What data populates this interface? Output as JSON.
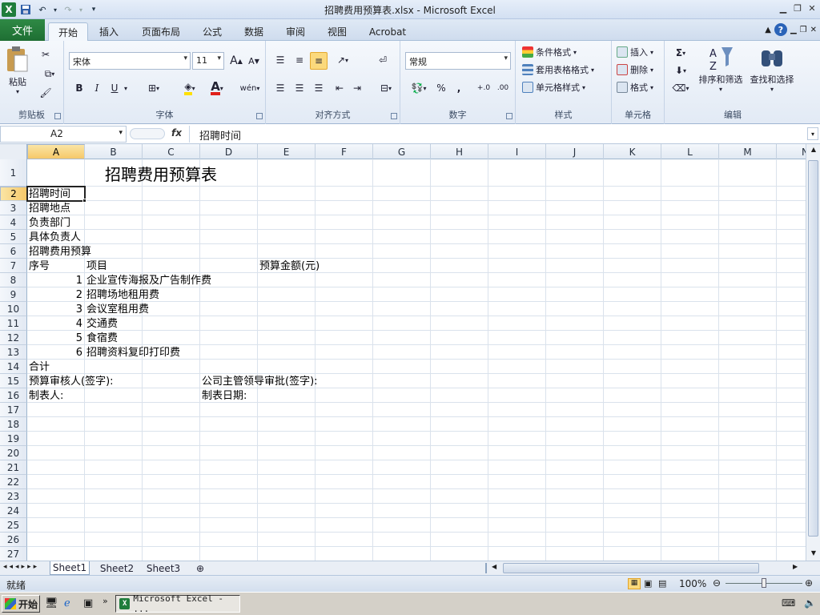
{
  "window": {
    "title": "招聘费用预算表.xlsx - Microsoft Excel"
  },
  "tabs": {
    "file": "文件",
    "items": [
      "开始",
      "插入",
      "页面布局",
      "公式",
      "数据",
      "审阅",
      "视图",
      "Acrobat"
    ],
    "active": "开始"
  },
  "ribbon": {
    "clipboard": {
      "paste": "粘贴",
      "label": "剪贴板"
    },
    "font": {
      "name": "宋体",
      "size": "11",
      "bold": "B",
      "italic": "I",
      "underline": "U",
      "label": "字体",
      "fontcolor_glyph": "A",
      "phonetic": "wén"
    },
    "alignment": {
      "label": "对齐方式"
    },
    "number": {
      "format": "常规",
      "percent": "%",
      "comma": ",",
      "label": "数字",
      "inc_decimal": "+.0",
      "dec_decimal": ".00"
    },
    "styles": {
      "conditional": "条件格式",
      "table": "套用表格格式",
      "cell": "单元格样式",
      "label": "样式"
    },
    "cells": {
      "insert": "插入",
      "delete": "删除",
      "format": "格式",
      "label": "单元格"
    },
    "editing": {
      "sort": "排序和筛选",
      "find": "查找和选择",
      "label": "编辑",
      "sum": "Σ"
    }
  },
  "formula": {
    "namebox": "A2",
    "fx": "fx",
    "content": "招聘时间"
  },
  "columns": [
    "A",
    "B",
    "C",
    "D",
    "E",
    "F",
    "G",
    "H",
    "I",
    "J",
    "K",
    "L",
    "M",
    "N"
  ],
  "rows": [
    "1",
    "2",
    "3",
    "4",
    "5",
    "6",
    "7",
    "8",
    "9",
    "10",
    "11",
    "12",
    "13",
    "14",
    "15",
    "16",
    "17",
    "18",
    "19",
    "20",
    "21",
    "22",
    "23",
    "24",
    "25",
    "26",
    "27"
  ],
  "cells": {
    "title": "招聘费用预算表",
    "a2": "招聘时间",
    "a3": "招聘地点",
    "a4": "负责部门",
    "a5": "具体负责人",
    "a6": "招聘费用预算",
    "a7": "序号",
    "b7": "项目",
    "e7": "预算金额(元)",
    "items": [
      {
        "no": "1",
        "name": "企业宣传海报及广告制作费"
      },
      {
        "no": "2",
        "name": "招聘场地租用费"
      },
      {
        "no": "3",
        "name": "会议室租用费"
      },
      {
        "no": "4",
        "name": "交通费"
      },
      {
        "no": "5",
        "name": "食宿费"
      },
      {
        "no": "6",
        "name": "招聘资料复印打印费"
      }
    ],
    "a14": "合计",
    "a15": "预算审核人(签字):",
    "d15": "公司主管领导审批(签字):",
    "a16": "制表人:",
    "d16": "制表日期:"
  },
  "sheets": [
    "Sheet1",
    "Sheet2",
    "Sheet3"
  ],
  "status": {
    "ready": "就绪",
    "zoom": "100%"
  },
  "taskbar": {
    "start": "开始",
    "item": "Microsoft Excel - ..."
  }
}
